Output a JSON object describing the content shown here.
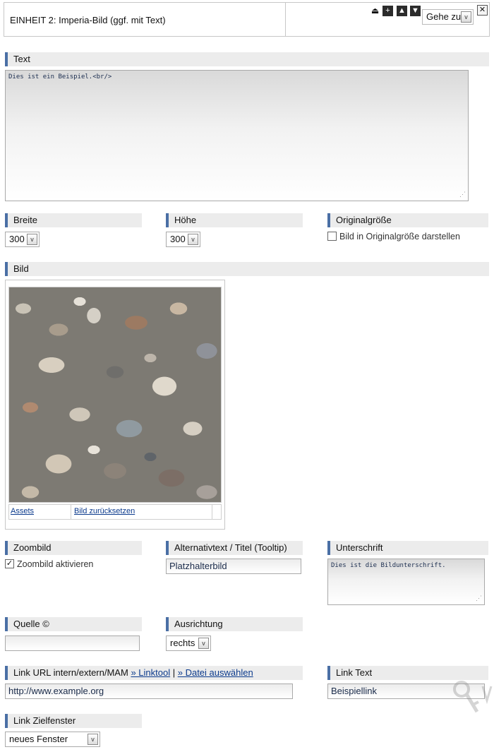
{
  "header": {
    "title": "EINHEIT 2: Imperia-Bild (ggf. mit Text)",
    "goto_label": "Gehe zu",
    "tools": {
      "collapse": "⏏",
      "add": "+",
      "up": "▲",
      "down": "▼",
      "close": "✕"
    }
  },
  "text_section": {
    "label": "Text",
    "value": "Dies ist ein Beispiel.<br/>"
  },
  "breite": {
    "label": "Breite",
    "value": "300"
  },
  "hoehe": {
    "label": "Höhe",
    "value": "300"
  },
  "originalgroesse": {
    "label": "Originalgröße",
    "checkbox_label": "Bild in Originalgröße darstellen",
    "checked": false
  },
  "bild": {
    "label": "Bild",
    "assets_link": "Assets",
    "reset_link": "Bild zurücksetzen"
  },
  "zoombild": {
    "label": "Zoombild",
    "checkbox_label": "Zoombild aktivieren",
    "checked": true,
    "check_mark": "✓"
  },
  "alttext": {
    "label": "Alternativtext / Titel (Tooltip)",
    "value": "Platzhalterbild"
  },
  "unterschrift": {
    "label": "Unterschrift",
    "value": "Dies ist die Bildunterschrift."
  },
  "quelle": {
    "label": "Quelle ©",
    "value": ""
  },
  "ausrichtung": {
    "label": "Ausrichtung",
    "value": "rechts"
  },
  "link_url": {
    "label": "Link URL intern/extern/MAM",
    "linktool": "» Linktool",
    "separator": "|",
    "datei": "» Datei auswählen",
    "value": "http://www.example.org"
  },
  "link_text": {
    "label": "Link Text",
    "value": "Beispiellink"
  },
  "link_ziel": {
    "label": "Link Zielfenster",
    "value": "neues Fenster"
  },
  "icons": {
    "dropdown_arrow": "v",
    "resize_grip": "⋰"
  }
}
